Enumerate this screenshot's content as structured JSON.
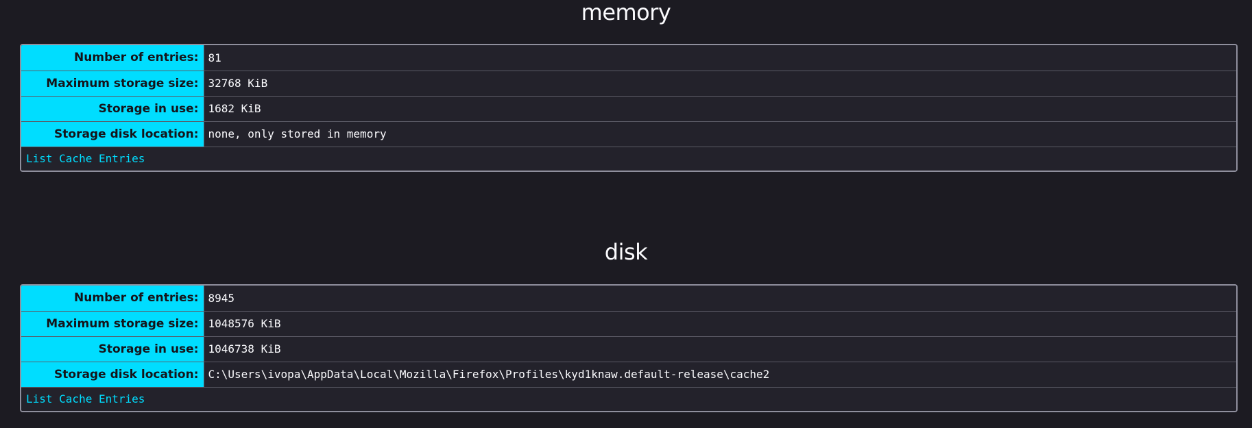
{
  "sections": [
    {
      "title": "memory",
      "rows": [
        {
          "label": "Number of entries:",
          "value": "81"
        },
        {
          "label": "Maximum storage size:",
          "value": "32768 KiB"
        },
        {
          "label": "Storage in use:",
          "value": "1682 KiB"
        },
        {
          "label": "Storage disk location:",
          "value": "none, only stored in memory"
        }
      ],
      "link_label": "List Cache Entries"
    },
    {
      "title": "disk",
      "rows": [
        {
          "label": "Number of entries:",
          "value": "8945"
        },
        {
          "label": "Maximum storage size:",
          "value": "1048576 KiB"
        },
        {
          "label": "Storage in use:",
          "value": "1046738 KiB"
        },
        {
          "label": "Storage disk location:",
          "value": "C:\\Users\\ivopa\\AppData\\Local\\Mozilla\\Firefox\\Profiles\\kyd1knaw.default-release\\cache2"
        }
      ],
      "link_label": "List Cache Entries"
    }
  ],
  "colors": {
    "background": "#1c1b22",
    "header_cell": "#00ddff",
    "link": "#00ddff",
    "border": "#8f8f9d"
  }
}
